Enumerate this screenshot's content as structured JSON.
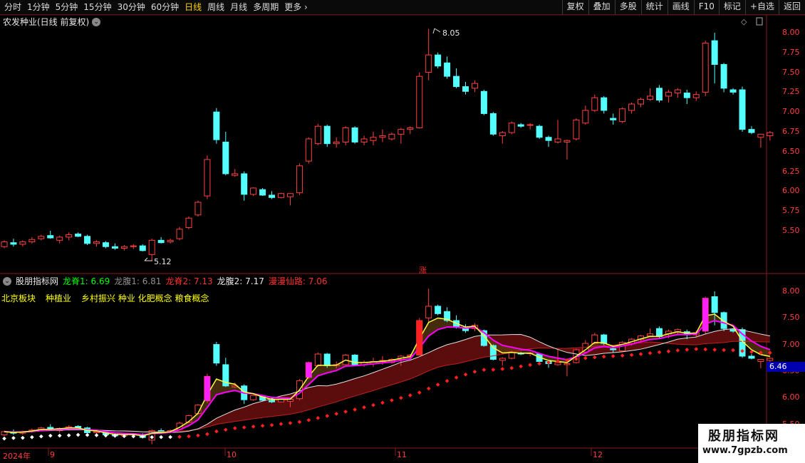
{
  "toolbar": {
    "periods": [
      "分时",
      "1分钟",
      "5分钟",
      "15分钟",
      "30分钟",
      "60分钟",
      "日线",
      "周线",
      "月线",
      "多周期",
      "更多"
    ],
    "active_index": 6,
    "right_buttons": [
      "复权",
      "叠加",
      "多股",
      "统计",
      "画线",
      "F10",
      "标记",
      "+自选",
      "返回"
    ]
  },
  "main_panel": {
    "title": "农发种业(日线 前复权)",
    "high_label": "8.05",
    "low_label": "5.12",
    "limit_up_mark": "涨",
    "yticks": [
      "8.00",
      "7.75",
      "7.50",
      "7.25",
      "7.00",
      "6.75",
      "6.50",
      "6.25",
      "6.00",
      "5.75",
      "5.50"
    ]
  },
  "indicator_panel": {
    "name": "股朋指标网",
    "values": [
      {
        "label": "龙脊1:",
        "value": "6.69",
        "color": "#00ff00"
      },
      {
        "label": "龙腹1:",
        "value": "6.81",
        "color": "#909090"
      },
      {
        "label": "龙脊2:",
        "value": "7.13",
        "color": "#ff3030"
      },
      {
        "label": "龙腹2:",
        "value": "7.17",
        "color": "#e8e8e8"
      },
      {
        "label": "漫漫仙路:",
        "value": "7.06",
        "color": "#ff3030"
      }
    ],
    "concepts": [
      "北京板块",
      "种植业",
      "乡村振兴 种业 化肥概念 粮食概念"
    ],
    "yticks": [
      "8.00",
      "7.50",
      "7.00",
      "6.50",
      "6.00",
      "5.50"
    ],
    "current_price": "6.46"
  },
  "date_axis": {
    "labels": [
      {
        "text": "2024年",
        "x": 4
      },
      {
        "text": "9",
        "x": 70
      },
      {
        "text": "10",
        "x": 318
      },
      {
        "text": "11",
        "x": 557
      },
      {
        "text": "12",
        "x": 832
      }
    ]
  },
  "watermark": {
    "main": "股朋指标网",
    "url": "www.7gpzb.com"
  },
  "chart_data": {
    "type": "candlestick",
    "ohlc": [
      [
        5.3,
        5.38,
        5.28,
        5.36
      ],
      [
        5.35,
        5.4,
        5.3,
        5.33
      ],
      [
        5.33,
        5.38,
        5.3,
        5.36
      ],
      [
        5.36,
        5.42,
        5.34,
        5.39
      ],
      [
        5.4,
        5.45,
        5.38,
        5.43
      ],
      [
        5.44,
        5.5,
        5.4,
        5.41
      ],
      [
        5.38,
        5.44,
        5.34,
        5.42
      ],
      [
        5.42,
        5.48,
        5.38,
        5.45
      ],
      [
        5.46,
        5.48,
        5.42,
        5.43
      ],
      [
        5.43,
        5.45,
        5.32,
        5.34
      ],
      [
        5.34,
        5.38,
        5.3,
        5.36
      ],
      [
        5.35,
        5.37,
        5.28,
        5.3
      ],
      [
        5.3,
        5.34,
        5.26,
        5.28
      ],
      [
        5.28,
        5.32,
        5.25,
        5.3
      ],
      [
        5.3,
        5.33,
        5.27,
        5.31
      ],
      [
        5.31,
        5.33,
        5.24,
        5.25
      ],
      [
        5.2,
        5.4,
        5.12,
        5.38
      ],
      [
        5.38,
        5.42,
        5.34,
        5.35
      ],
      [
        5.36,
        5.4,
        5.34,
        5.38
      ],
      [
        5.4,
        5.55,
        5.38,
        5.52
      ],
      [
        5.54,
        5.68,
        5.52,
        5.66
      ],
      [
        5.7,
        5.88,
        5.68,
        5.86
      ],
      [
        5.94,
        6.45,
        5.9,
        6.4
      ],
      [
        7.0,
        7.05,
        6.6,
        6.65
      ],
      [
        6.62,
        6.75,
        6.2,
        6.22
      ],
      [
        6.2,
        6.28,
        6.18,
        6.22
      ],
      [
        6.22,
        6.25,
        5.88,
        5.96
      ],
      [
        5.96,
        6.05,
        5.94,
        6.04
      ],
      [
        6.02,
        6.04,
        5.94,
        5.95
      ],
      [
        5.95,
        6.0,
        5.9,
        5.92
      ],
      [
        5.92,
        5.98,
        5.91,
        5.97
      ],
      [
        5.93,
        5.96,
        5.82,
        5.97
      ],
      [
        5.98,
        6.35,
        5.95,
        6.32
      ],
      [
        6.38,
        6.68,
        6.35,
        6.66
      ],
      [
        6.6,
        6.85,
        6.58,
        6.82
      ],
      [
        6.82,
        6.84,
        6.56,
        6.6
      ],
      [
        6.6,
        6.68,
        6.55,
        6.62
      ],
      [
        6.62,
        6.82,
        6.58,
        6.8
      ],
      [
        6.8,
        6.82,
        6.6,
        6.62
      ],
      [
        6.62,
        6.7,
        6.58,
        6.66
      ],
      [
        6.64,
        6.75,
        6.58,
        6.68
      ],
      [
        6.68,
        6.78,
        6.62,
        6.7
      ],
      [
        6.66,
        6.74,
        6.64,
        6.72
      ],
      [
        6.72,
        6.8,
        6.6,
        6.78
      ],
      [
        6.78,
        6.82,
        6.72,
        6.8
      ],
      [
        6.8,
        7.5,
        6.79,
        7.45
      ],
      [
        7.5,
        8.05,
        7.4,
        7.72
      ],
      [
        7.72,
        7.75,
        7.55,
        7.58
      ],
      [
        7.62,
        7.7,
        7.42,
        7.45
      ],
      [
        7.45,
        7.55,
        7.3,
        7.32
      ],
      [
        7.32,
        7.38,
        7.22,
        7.26
      ],
      [
        7.3,
        7.4,
        7.25,
        7.36
      ],
      [
        7.26,
        7.28,
        6.96,
        6.98
      ],
      [
        6.98,
        7.0,
        6.7,
        6.72
      ],
      [
        6.7,
        6.76,
        6.6,
        6.74
      ],
      [
        6.74,
        6.88,
        6.72,
        6.86
      ],
      [
        6.84,
        6.86,
        6.8,
        6.82
      ],
      [
        6.84,
        6.86,
        6.78,
        6.84
      ],
      [
        6.82,
        6.84,
        6.66,
        6.68
      ],
      [
        6.68,
        6.7,
        6.56,
        6.64
      ],
      [
        6.62,
        6.9,
        6.6,
        6.66
      ],
      [
        6.62,
        6.65,
        6.4,
        6.64
      ],
      [
        6.66,
        6.92,
        6.64,
        6.9
      ],
      [
        6.86,
        7.08,
        6.84,
        7.02
      ],
      [
        7.02,
        7.22,
        7.0,
        7.18
      ],
      [
        7.18,
        7.2,
        6.98,
        7.02
      ],
      [
        6.92,
        6.98,
        6.84,
        6.9
      ],
      [
        6.88,
        7.06,
        6.86,
        7.04
      ],
      [
        7.02,
        7.12,
        6.98,
        7.1
      ],
      [
        7.1,
        7.18,
        7.06,
        7.16
      ],
      [
        7.16,
        7.3,
        7.14,
        7.2
      ],
      [
        7.3,
        7.34,
        7.12,
        7.15
      ],
      [
        7.2,
        7.28,
        7.12,
        7.25
      ],
      [
        7.24,
        7.3,
        7.18,
        7.28
      ],
      [
        7.24,
        7.28,
        7.1,
        7.18
      ],
      [
        7.18,
        7.26,
        7.14,
        7.22
      ],
      [
        7.25,
        7.9,
        7.2,
        7.87
      ],
      [
        7.9,
        8.0,
        7.36,
        7.6
      ],
      [
        7.6,
        7.62,
        7.25,
        7.3
      ],
      [
        7.28,
        7.3,
        7.22,
        7.25
      ],
      [
        7.28,
        7.32,
        6.75,
        6.78
      ],
      [
        6.78,
        6.82,
        6.72,
        6.74
      ],
      [
        6.68,
        6.72,
        6.55,
        6.72
      ],
      [
        6.7,
        6.76,
        6.64,
        6.74
      ]
    ]
  }
}
